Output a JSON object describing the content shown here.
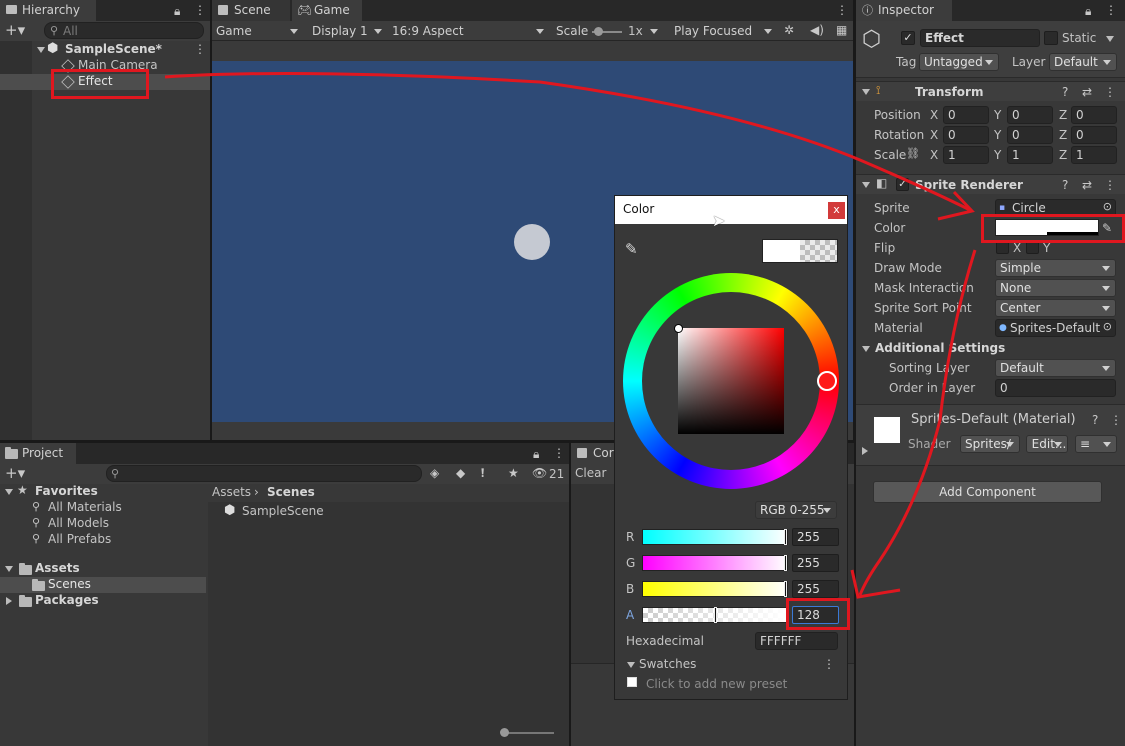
{
  "hierarchy": {
    "tab": "Hierarchy",
    "search_placeholder": "All",
    "scene": "SampleScene*",
    "items": [
      "Main Camera",
      "Effect"
    ]
  },
  "scene_tab": "Scene",
  "game": {
    "tab": "Game",
    "mode": "Game",
    "display": "Display 1",
    "aspect": "16:9 Aspect",
    "scale_label": "Scale",
    "scale_value": "1x",
    "play_mode": "Play Focused",
    "background_color": "#2e4a76",
    "circle_color": "#c5c9d2"
  },
  "project": {
    "tab": "Project",
    "hidden_count": "21",
    "favorites_label": "Favorites",
    "favorites": [
      "All Materials",
      "All Models",
      "All Prefabs"
    ],
    "assets_label": "Assets",
    "assets_children": [
      "Scenes"
    ],
    "packages_label": "Packages",
    "breadcrumb": [
      "Assets",
      "Scenes"
    ],
    "files": [
      "SampleScene"
    ]
  },
  "console": {
    "tab": "Cor",
    "clear": "Clear"
  },
  "color_picker": {
    "title": "Color",
    "close": "x",
    "mode": "RGB 0-255",
    "channels": [
      {
        "label": "R",
        "value": "255",
        "fraction": 1.0
      },
      {
        "label": "G",
        "value": "255",
        "fraction": 1.0
      },
      {
        "label": "B",
        "value": "255",
        "fraction": 1.0
      },
      {
        "label": "A",
        "value": "128",
        "fraction": 0.502
      }
    ],
    "hex_label": "Hexadecimal",
    "hex_value": "FFFFFF",
    "swatches_label": "Swatches",
    "swatches_hint": "Click to add new preset"
  },
  "inspector": {
    "tab": "Inspector",
    "object_name": "Effect",
    "static_label": "Static",
    "tag_label": "Tag",
    "tag_value": "Untagged",
    "layer_label": "Layer",
    "layer_value": "Default",
    "transform": {
      "title": "Transform",
      "rows": [
        {
          "label": "Position",
          "x": "0",
          "y": "0",
          "z": "0"
        },
        {
          "label": "Rotation",
          "x": "0",
          "y": "0",
          "z": "0"
        },
        {
          "label": "Scale",
          "x": "1",
          "y": "1",
          "z": "1"
        }
      ]
    },
    "sprite_renderer": {
      "title": "Sprite Renderer",
      "sprite_label": "Sprite",
      "sprite_value": "Circle",
      "color_label": "Color",
      "flip_label": "Flip",
      "flip_x": "X",
      "flip_y": "Y",
      "draw_mode_label": "Draw Mode",
      "draw_mode_value": "Simple",
      "mask_label": "Mask Interaction",
      "mask_value": "None",
      "sort_point_label": "Sprite Sort Point",
      "sort_point_value": "Center",
      "material_label": "Material",
      "material_value": "Sprites-Default",
      "additional_settings": "Additional Settings",
      "sorting_layer_label": "Sorting Layer",
      "sorting_layer_value": "Default",
      "order_label": "Order in Layer",
      "order_value": "0"
    },
    "material": {
      "name": "Sprites-Default (Material)",
      "shader_label": "Shader",
      "shader_value": "Sprites/",
      "edit": "Edit..."
    },
    "add_component": "Add Component"
  },
  "colors": {
    "annotation_red": "#e0171f",
    "editor_bg": "#383838"
  }
}
